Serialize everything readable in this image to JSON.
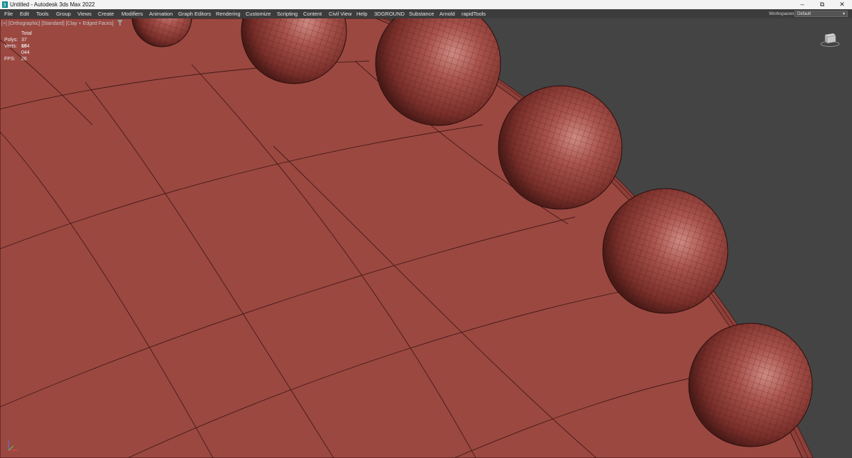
{
  "window": {
    "title": "Untitled - Autodesk 3ds Max 2022",
    "buttons": {
      "minimize": "–",
      "restore": "⧉",
      "close": "✕"
    }
  },
  "menu": {
    "items": [
      "File",
      "Edit",
      "Tools",
      "Group",
      "Views",
      "Create",
      "Modifiers",
      "Animation",
      "Graph Editors",
      "Rendering",
      "Customize",
      "Scripting",
      "Content",
      "Civil View",
      "Help",
      "3DGROUND",
      "Substance",
      "Arnold",
      "rapidTools"
    ],
    "workspaces_label": "Workspaces:",
    "workspaces_value": "Default"
  },
  "viewport": {
    "label_plus": "[+]",
    "label_view": "[Orthographic]",
    "label_shading": "[Standard]",
    "label_mode": "[Clay + Edged Faces]",
    "stats": {
      "total_label": "Total",
      "polys_label": "Polys:",
      "polys_value": "37 664",
      "verts_label": "Verts:",
      "verts_value": "19 044",
      "fps_label": "FPS:",
      "fps_value": "26"
    }
  },
  "colors": {
    "clay": "#9a4640",
    "sphere_light": "#c97a72",
    "sphere_dark": "#4a1a17",
    "wire": "#3a1512",
    "background": "#444444",
    "menubar": "#3c3c3c"
  },
  "icons": {
    "app": "3dsmax-app-icon",
    "filter": "filter-icon",
    "viewcube": "viewcube-icon",
    "axis": "axis-tripod-icon"
  }
}
